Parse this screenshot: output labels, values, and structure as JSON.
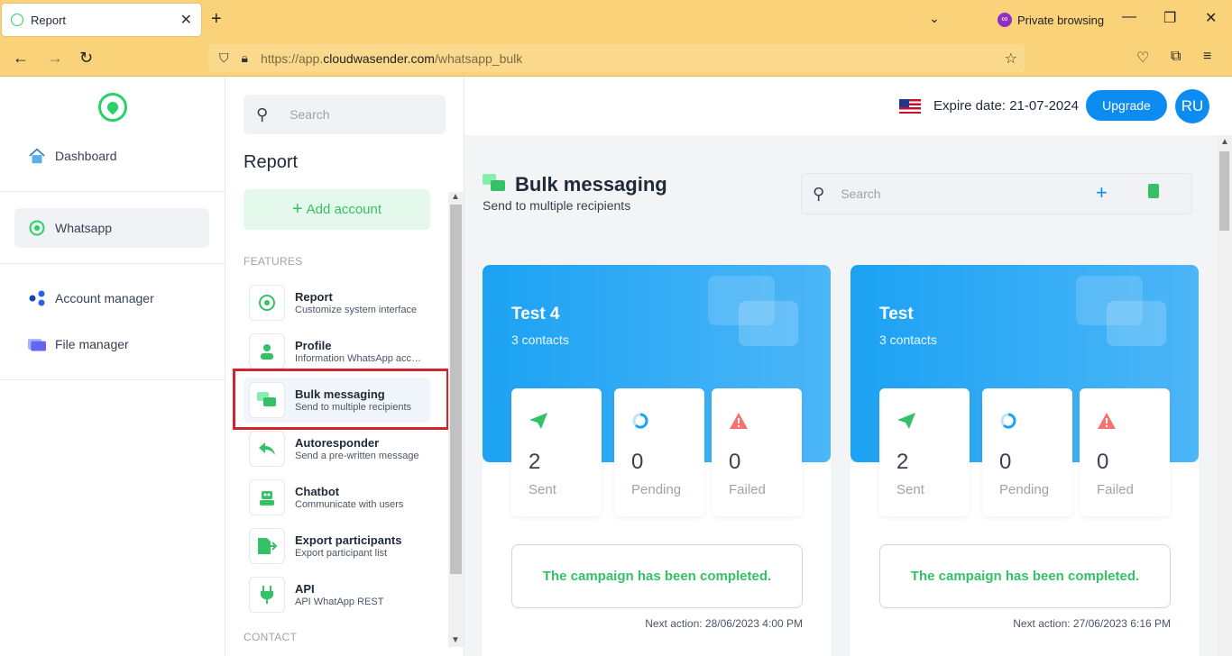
{
  "browser": {
    "tab_title": "Report",
    "private_label": "Private browsing",
    "url": {
      "prefix": "https://app.",
      "host": "cloudwasender.com",
      "path": "/whatsapp_bulk"
    }
  },
  "leftnav": {
    "items": [
      {
        "label": "Dashboard"
      },
      {
        "label": "Whatsapp"
      },
      {
        "label": "Account manager"
      },
      {
        "label": "File manager"
      }
    ]
  },
  "features_panel": {
    "search_placeholder": "Search",
    "title": "Report",
    "add_account": "Add account",
    "section_features": "FEATURES",
    "section_contact": "CONTACT",
    "items": [
      {
        "title": "Report",
        "desc": "Customize system interface"
      },
      {
        "title": "Profile",
        "desc": "Information WhatsApp account"
      },
      {
        "title": "Bulk messaging",
        "desc": "Send to multiple recipients"
      },
      {
        "title": "Autoresponder",
        "desc": "Send a pre-written message"
      },
      {
        "title": "Chatbot",
        "desc": "Communicate with users"
      },
      {
        "title": "Export participants",
        "desc": "Export participant list"
      },
      {
        "title": "API",
        "desc": "API WhatApp REST"
      }
    ]
  },
  "topbar": {
    "expire": "Expire date: 21-07-2024",
    "upgrade": "Upgrade",
    "avatar": "RU"
  },
  "page": {
    "title": "Bulk messaging",
    "subtitle": "Send to multiple recipients",
    "search_placeholder": "Search"
  },
  "campaigns": [
    {
      "name": "Test 4",
      "contacts": "3 contacts",
      "sent": "2",
      "pending": "0",
      "failed": "0",
      "labels": {
        "sent": "Sent",
        "pending": "Pending",
        "failed": "Failed"
      },
      "status": "The campaign has been completed.",
      "next": "Next action: 28/06/2023 4:00 PM"
    },
    {
      "name": "Test",
      "contacts": "3 contacts",
      "sent": "2",
      "pending": "0",
      "failed": "0",
      "labels": {
        "sent": "Sent",
        "pending": "Pending",
        "failed": "Failed"
      },
      "status": "The campaign has been completed.",
      "next": "Next action: 27/06/2023 6:16 PM"
    }
  ],
  "colors": {
    "accent": "#0c8cf0",
    "green": "#34c167",
    "highlight": "#d3232f"
  }
}
